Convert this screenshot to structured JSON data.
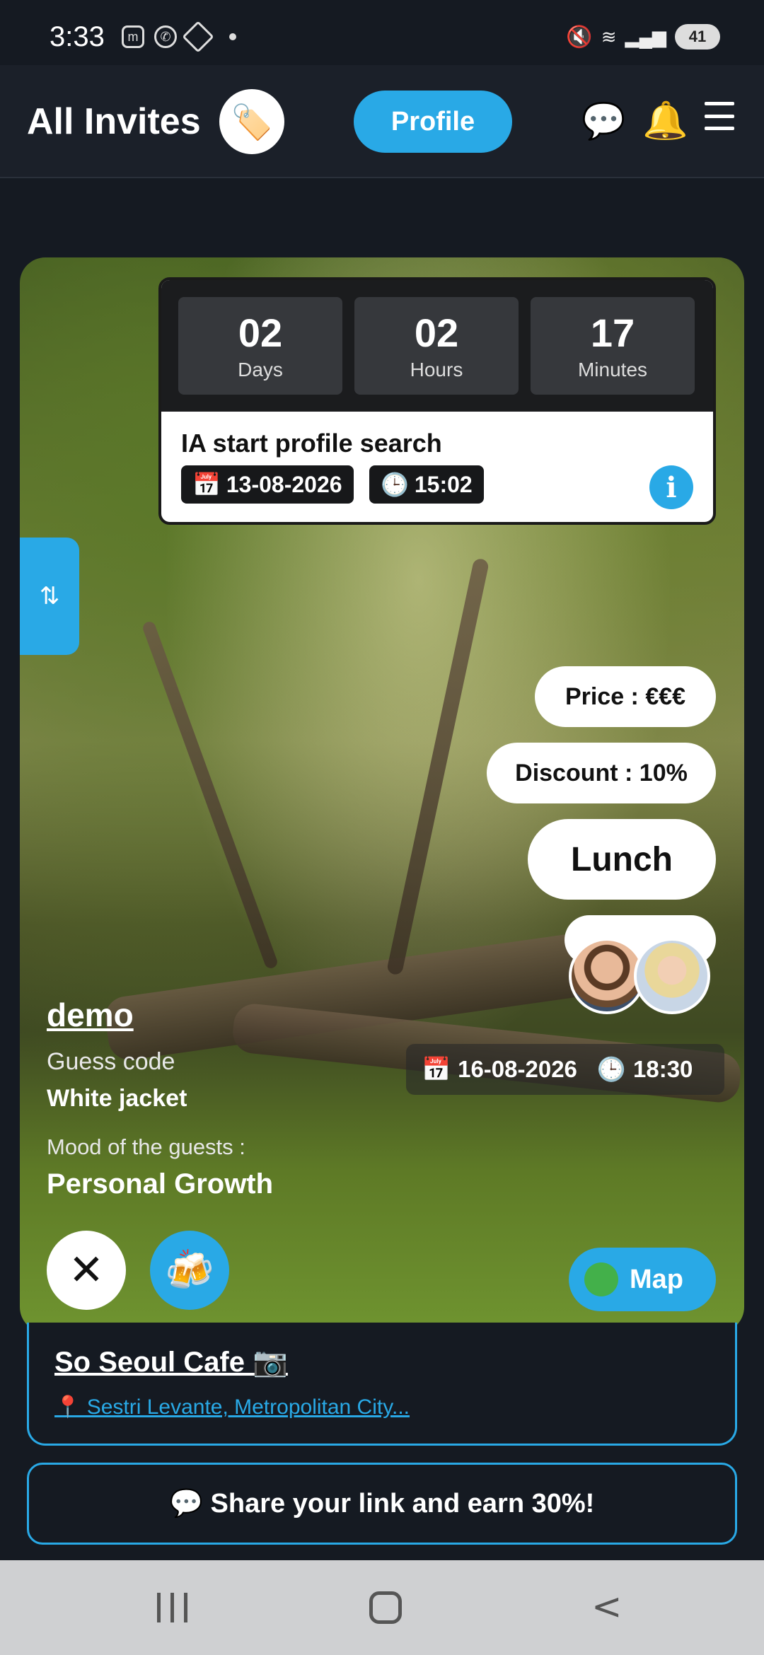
{
  "status_bar": {
    "time": "3:33",
    "icons_left": [
      "m",
      "whatsapp-icon",
      "diamond-icon"
    ],
    "battery": "41"
  },
  "header": {
    "title": "All Invites",
    "tag_icon": "🏷️",
    "profile_label": "Profile",
    "chat_icon": "💬",
    "bell_icon": "🔔"
  },
  "countdown": {
    "days": "02",
    "days_label": "Days",
    "hours": "02",
    "hours_label": "Hours",
    "minutes": "17",
    "minutes_label": "Minutes",
    "title": "IA start profile search",
    "date": "13-08-2026",
    "time": "15:02",
    "info": "i"
  },
  "side_tab_icon": "⇅",
  "pills": {
    "price": "Price : €€€",
    "discount": "Discount : 10%",
    "meal": "Lunch"
  },
  "event": {
    "name": "demo",
    "guess_code_label": "Guess code",
    "guess_code_value": "White jacket",
    "mood_label": "Mood of the guests :",
    "mood_value": "Personal Growth",
    "date": "16-08-2026",
    "time": "18:30"
  },
  "actions": {
    "close_icon": "✕",
    "cheers_icon": "🍻",
    "map_label": "Map"
  },
  "location": {
    "name": "So Seoul Cafe 📷",
    "address": "📍 Sestri Levante, Metropolitan City..."
  },
  "share": {
    "label": "💬 Share your link and earn 30%!"
  },
  "colors": {
    "accent": "#29a9e6",
    "background": "#151a22"
  }
}
